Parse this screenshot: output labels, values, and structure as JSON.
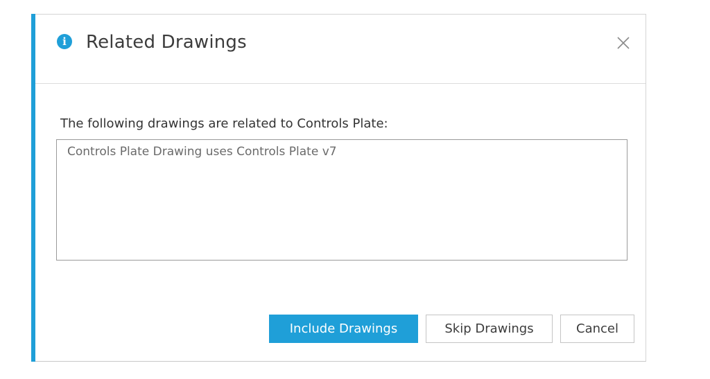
{
  "dialog": {
    "title": "Related Drawings",
    "info_icon_glyph": "i",
    "close_icon": "close-icon",
    "message": "The following drawings are related to Controls Plate:",
    "related_items": [
      "Controls Plate Drawing uses Controls Plate v7"
    ],
    "buttons": {
      "include": "Include Drawings",
      "skip": "Skip Drawings",
      "cancel": "Cancel"
    }
  },
  "colors": {
    "accent": "#1f9fd8",
    "title_text": "#3c3c3c",
    "border": "#c4c4c4"
  }
}
